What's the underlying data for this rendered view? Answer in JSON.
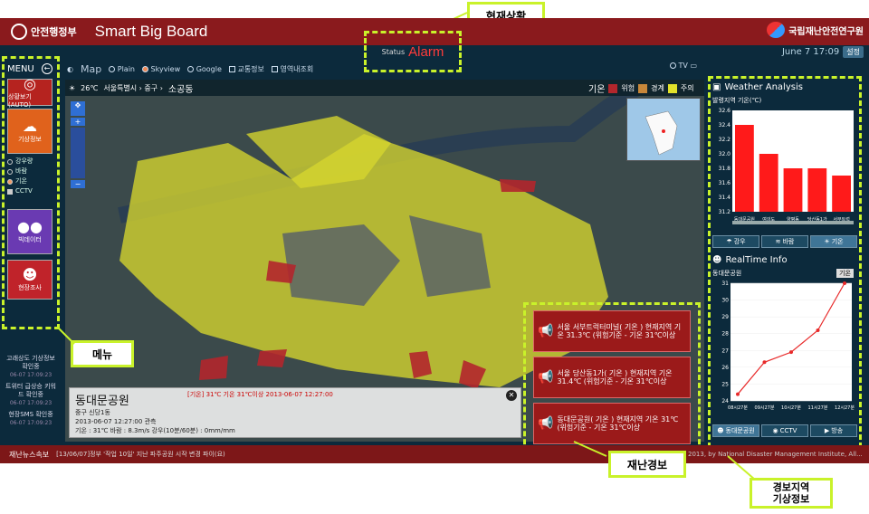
{
  "topbar": {
    "org_logo_text": "안전행정부",
    "app_title": "Smart Big Board",
    "right_logo_text": "국립재난안전연구원",
    "date": "June 7 17:09",
    "date_button": "설정"
  },
  "status": {
    "label": "Status",
    "value": "Alarm"
  },
  "menu": {
    "title": "MENU",
    "buttons": [
      {
        "label": "상황보기 (AUTO)",
        "icon": "binoculars-icon",
        "color": "#b5231f"
      },
      {
        "label": "기상정보",
        "icon": "weather-icon",
        "color": "#e0621c"
      },
      {
        "label": "빅데이터",
        "icon": "people-icon",
        "color": "#6a3ab2"
      },
      {
        "label": "현장조사",
        "icon": "person-bubble-icon",
        "color": "#c0232a"
      }
    ],
    "sub_items": [
      "강우량",
      "바람",
      "기온",
      "CCTV"
    ],
    "side_alerts": [
      {
        "title": "고래상도 기상정보 확인중",
        "time": "06-07 17:09:23"
      },
      {
        "title": "트위터 급상승 키워드 확인중",
        "time": "06-07 17:09:23"
      },
      {
        "title": "현장SMS 확인중",
        "time": "06-07 17:09:23"
      }
    ]
  },
  "map_header": {
    "title": "Map",
    "options": [
      "Plain",
      "Skyview",
      "Google"
    ],
    "checks": [
      "교통정보",
      "영역내조회"
    ],
    "tv": "TV"
  },
  "map": {
    "temp": "26℃",
    "breadcrumb": "서울특별시 › 중구 ›",
    "location": "소공동",
    "legend_title": "기온",
    "legend": [
      {
        "label": "위험",
        "color": "#b3262c"
      },
      {
        "label": "경계",
        "color": "#c8873a"
      },
      {
        "label": "주의",
        "color": "#e2e12a"
      }
    ],
    "zoom_in": "+",
    "zoom_out": "−"
  },
  "info_box": {
    "place": "동대문공원",
    "address": "중구 신당1동",
    "badge": "[기온] 31℃ 기온 31℃이상 2013-06-07 12:27:00",
    "time_line": "2013-06-07 12:27:00 관측",
    "reading": "기온 : 31℃ 바람 : 8.3m/s 강우(10분/60분) : 0mm/mm",
    "close": "✕"
  },
  "alerts": [
    {
      "text": "서울 서부트럭터미널( 기온 ) 현재지역 기온 31.3℃ (위험기준 - 기온 31℃이상"
    },
    {
      "text": "서울 당산동1가( 기온 ) 현재지역 기온 31.4℃ (위험기준 - 기온 31℃이상"
    },
    {
      "text": "동대문공원( 기온 ) 현재지역 기온 31℃ (위험기준 - 기온 31℃이상"
    }
  ],
  "weather_analysis": {
    "title": "Weather Analysis",
    "subtitle": "발령지역 기온(℃)",
    "tabs": [
      "강우",
      "바람",
      "기온"
    ]
  },
  "realtime": {
    "title": "RealTime Info",
    "station": "동대문공원",
    "select": "기온",
    "tabs": [
      "동대문공원",
      "CCTV",
      "방송"
    ]
  },
  "bottombar": {
    "news_label": "재난뉴스속보",
    "news": "[13/06/07]정부 '작업 10일' 지난 파주공원 시작 변경 파이(요)",
    "copyright": "2013, by National Disaster Management Institute, All..."
  },
  "annotations": {
    "status": "현재상황",
    "menu": "메뉴",
    "alert": "재난경보",
    "region": "경보지역\n기상정보"
  },
  "chart_data": [
    {
      "type": "bar",
      "title": "발령지역 기온(℃)",
      "categories": [
        "동대문공원",
        "여의도",
        "양평동",
        "당산동1가",
        "서부트럭"
      ],
      "values": [
        32.4,
        32.0,
        31.8,
        31.8,
        31.7
      ],
      "ylim": [
        31.2,
        32.6
      ],
      "yticks": [
        31.2,
        31.4,
        31.6,
        31.8,
        32.0,
        32.2,
        32.4,
        32.6
      ],
      "color": "#ff1a1a"
    },
    {
      "type": "line",
      "title": "동대문공원",
      "x": [
        "08시27분",
        "09시27분",
        "10시27분",
        "11시27분",
        "12시27분"
      ],
      "values": [
        24.4,
        26.3,
        26.9,
        28.2,
        31.0
      ],
      "ylim": [
        24,
        31
      ],
      "yticks": [
        24,
        25,
        26,
        27,
        28,
        29,
        30,
        31
      ],
      "color": "#e82a2a"
    }
  ]
}
